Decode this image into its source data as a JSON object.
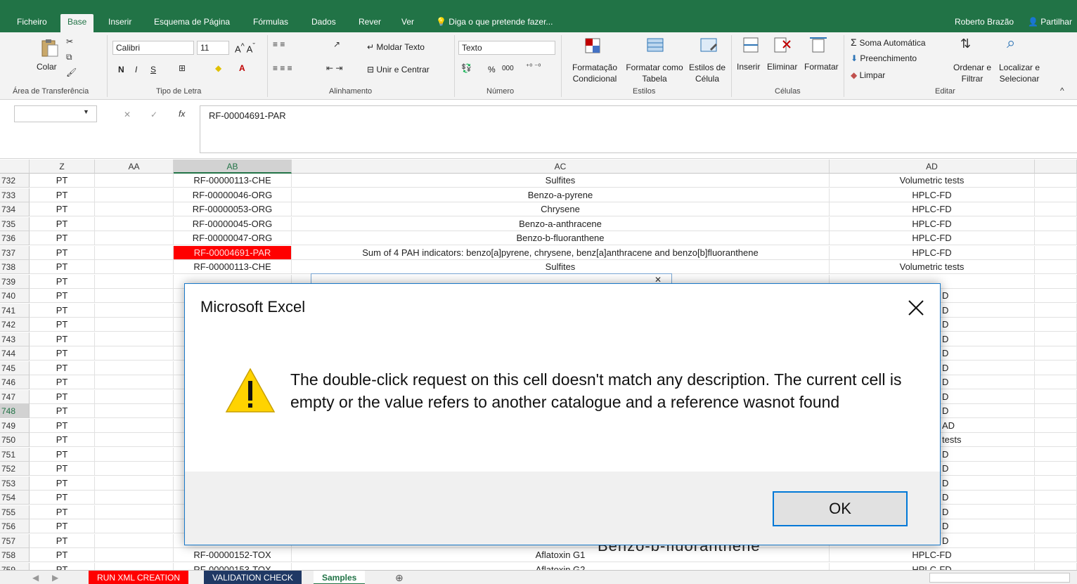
{
  "ribbon_tabs": [
    "Ficheiro",
    "Base",
    "Inserir",
    "Esquema de Página",
    "Fórmulas",
    "Dados",
    "Rever",
    "Ver"
  ],
  "tell_me": "Diga o que pretende fazer...",
  "user": "Roberto Brazão",
  "share": "Partilhar",
  "clipboard": {
    "paste": "Colar",
    "group": "Área de Transferência"
  },
  "font": {
    "name": "Calibri",
    "size": "11",
    "bold": "N",
    "italic": "I",
    "underline": "S",
    "group": "Tipo de Letra"
  },
  "alignment": {
    "wrap": "Moldar Texto",
    "merge": "Unir e Centrar",
    "group": "Alinhamento"
  },
  "number": {
    "format": "Texto",
    "percent": "%",
    "thousands": "000",
    "group": "Número"
  },
  "styles": {
    "conditional": "Formatação Condicional",
    "table": "Formatar como Tabela",
    "cell": "Estilos de Célula",
    "group": "Estilos"
  },
  "cells": {
    "insert": "Inserir",
    "delete": "Eliminar",
    "format": "Formatar",
    "group": "Células"
  },
  "editing": {
    "autosum": "Soma Automática",
    "fill": "Preenchimento",
    "clear": "Limpar",
    "sort": "Ordenar e Filtrar",
    "find": "Localizar e Selecionar",
    "group": "Editar"
  },
  "formula_bar": {
    "name_box": "",
    "fx": "fx",
    "content": "RF-00004691-PAR"
  },
  "columns": [
    "Z",
    "AA",
    "AB",
    "AC",
    "AD"
  ],
  "rows": [
    {
      "n": "732",
      "z": "PT",
      "ab": "RF-00000113-CHE",
      "ac": "Sulfites",
      "ad": "Volumetric tests"
    },
    {
      "n": "733",
      "z": "PT",
      "ab": "RF-00000046-ORG",
      "ac": "Benzo-a-pyrene",
      "ad": "HPLC-FD"
    },
    {
      "n": "734",
      "z": "PT",
      "ab": "RF-00000053-ORG",
      "ac": "Chrysene",
      "ad": "HPLC-FD"
    },
    {
      "n": "735",
      "z": "PT",
      "ab": "RF-00000045-ORG",
      "ac": "Benzo-a-anthracene",
      "ad": "HPLC-FD"
    },
    {
      "n": "736",
      "z": "PT",
      "ab": "RF-00000047-ORG",
      "ac": "Benzo-b-fluoranthene",
      "ad": "HPLC-FD"
    },
    {
      "n": "737",
      "z": "PT",
      "ab": "RF-00004691-PAR",
      "ac": "Sum of 4 PAH indicators: benzo[a]pyrene, chrysene, benz[a]anthracene and benzo[b]fluoranthene",
      "ad": "HPLC-FD"
    },
    {
      "n": "738",
      "z": "PT",
      "ab": "RF-00000113-CHE",
      "ac": "Sulfites",
      "ad": "Volumetric tests"
    },
    {
      "n": "739",
      "z": "PT",
      "ab": "",
      "ac": "",
      "ad": ""
    },
    {
      "n": "740",
      "z": "PT",
      "ab": "",
      "ac": "",
      "ad": "D"
    },
    {
      "n": "741",
      "z": "PT",
      "ab": "",
      "ac": "",
      "ad": "D"
    },
    {
      "n": "742",
      "z": "PT",
      "ab": "",
      "ac": "",
      "ad": "D"
    },
    {
      "n": "743",
      "z": "PT",
      "ab": "",
      "ac": "",
      "ad": "D"
    },
    {
      "n": "744",
      "z": "PT",
      "ab": "",
      "ac": "",
      "ad": "D"
    },
    {
      "n": "745",
      "z": "PT",
      "ab": "",
      "ac": "",
      "ad": "D"
    },
    {
      "n": "746",
      "z": "PT",
      "ab": "",
      "ac": "",
      "ad": "D"
    },
    {
      "n": "747",
      "z": "PT",
      "ab": "",
      "ac": "",
      "ad": "D"
    },
    {
      "n": "748",
      "z": "PT",
      "ab": "",
      "ac": "",
      "ad": "D"
    },
    {
      "n": "749",
      "z": "PT",
      "ab": "",
      "ac": "",
      "ad": "AD"
    },
    {
      "n": "750",
      "z": "PT",
      "ab": "",
      "ac": "",
      "ad": "tests"
    },
    {
      "n": "751",
      "z": "PT",
      "ab": "",
      "ac": "",
      "ad": "D"
    },
    {
      "n": "752",
      "z": "PT",
      "ab": "",
      "ac": "",
      "ad": "D"
    },
    {
      "n": "753",
      "z": "PT",
      "ab": "",
      "ac": "",
      "ad": "D"
    },
    {
      "n": "754",
      "z": "PT",
      "ab": "",
      "ac": "",
      "ad": "D"
    },
    {
      "n": "755",
      "z": "PT",
      "ab": "",
      "ac": "",
      "ad": "D"
    },
    {
      "n": "756",
      "z": "PT",
      "ab": "",
      "ac": "",
      "ad": "D"
    },
    {
      "n": "757",
      "z": "PT",
      "ab": "",
      "ac": "",
      "ad": "D"
    },
    {
      "n": "758",
      "z": "PT",
      "ab": "RF-00000152-TOX",
      "ac": "Aflatoxin G1",
      "ad": "HPLC-FD"
    },
    {
      "n": "759",
      "z": "PT",
      "ab": "RF-00000153-TOX",
      "ac": "Aflatoxin G2",
      "ad": "HPLC-FD"
    }
  ],
  "sheets": [
    "RUN XML CREATION",
    "VALIDATION CHECK",
    "Samples"
  ],
  "dialog": {
    "title": "Microsoft Excel",
    "message": "The double-click request on this cell doesn't match any description. The current cell is empty or the value refers to another catalogue and a reference wasnot found",
    "ok": "OK",
    "behind_text": "Benzo-b-fluoranthene"
  },
  "colors": {
    "excel_green": "#217346",
    "highlight_red": "#ff0000",
    "dialog_blue": "#0078d7",
    "navy_tab": "#1f3864"
  }
}
